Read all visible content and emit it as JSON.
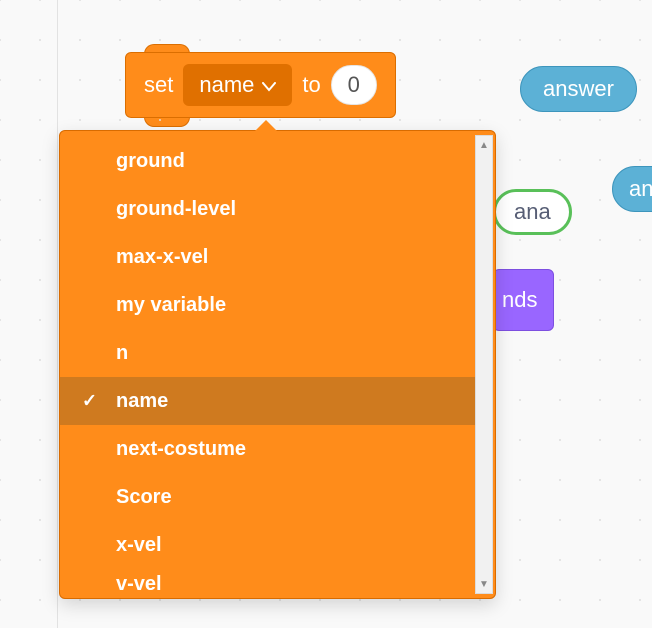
{
  "block": {
    "set_label": "set",
    "to_label": "to",
    "variable": "name",
    "value": "0"
  },
  "dropdown": {
    "items": [
      "ground",
      "ground-level",
      "max-x-vel",
      "my variable",
      "n",
      "name",
      "next-costume",
      "Score",
      "x-vel",
      "v-vel"
    ],
    "selected_index": 5
  },
  "background_blocks": {
    "answer1": "answer",
    "answer2": "ans",
    "banana_fragment": "ana",
    "purple_fragment": "nds"
  }
}
